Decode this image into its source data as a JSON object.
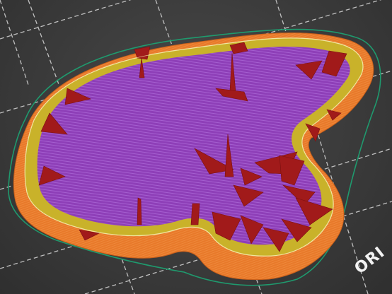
{
  "viewport": {
    "bed_label": "ORI",
    "colors": {
      "bed": "#3b3b3b",
      "grid": "#d8d8d8",
      "skirt": "#1f9a6e",
      "outer_wall": "#e8792a",
      "top_skin": "#c9b22a",
      "infill": "#8e3fb8",
      "support": "#a11a1a",
      "seam_line": "#f0e6a0"
    },
    "icons": {
      "print-preview": "gcode-preview-icon"
    }
  }
}
